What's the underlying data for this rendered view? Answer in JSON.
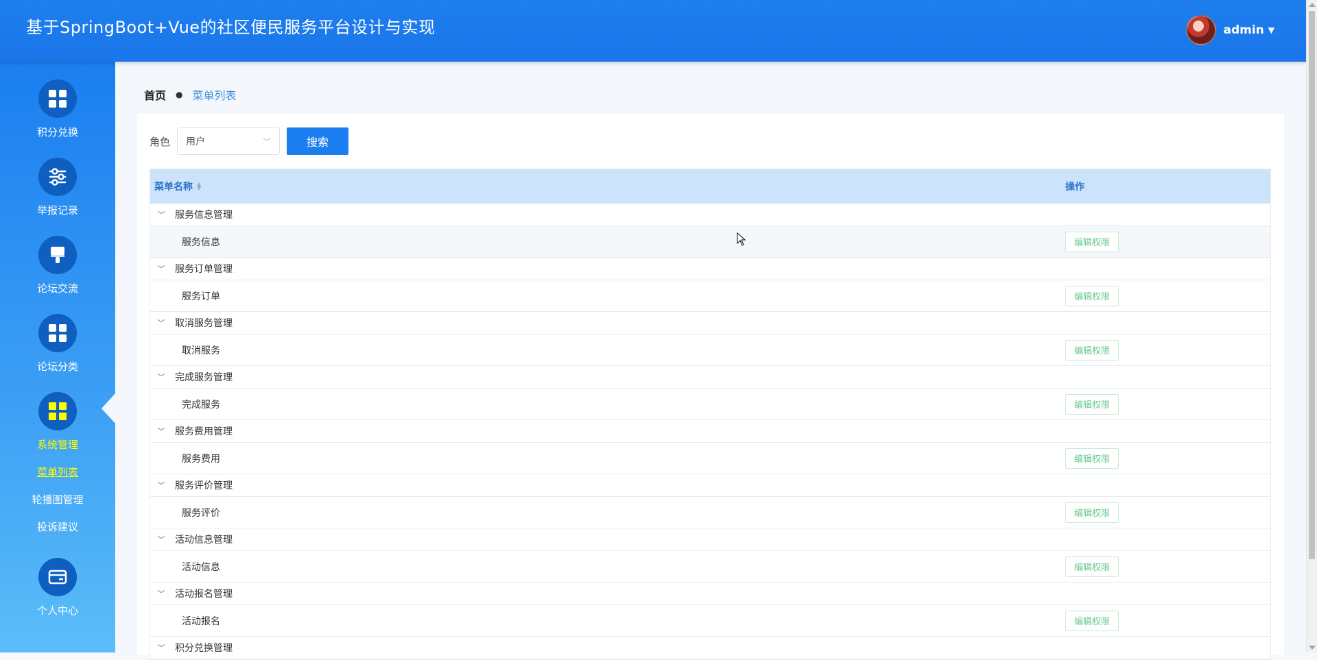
{
  "header": {
    "title": "基于SpringBoot+Vue的社区便民服务平台设计与实现",
    "username": "admin"
  },
  "sidebar": {
    "items": [
      {
        "label": "积分兑换",
        "icon": "grid-icon"
      },
      {
        "label": "举报记录",
        "icon": "sliders-icon"
      },
      {
        "label": "论坛交流",
        "icon": "brush-icon"
      },
      {
        "label": "论坛分类",
        "icon": "grid-icon"
      },
      {
        "label": "系统管理",
        "icon": "grid-icon",
        "active": true
      },
      {
        "label": "个人中心",
        "icon": "card-icon"
      }
    ],
    "subitems": [
      {
        "label": "菜单列表",
        "active": true
      },
      {
        "label": "轮播图管理"
      },
      {
        "label": "投诉建议"
      }
    ]
  },
  "breadcrumb": {
    "home": "首页",
    "current": "菜单列表"
  },
  "search": {
    "role_label": "角色",
    "role_value": "用户",
    "button": "搜索"
  },
  "table": {
    "columns": [
      "菜单名称",
      "操作"
    ],
    "edit_label": "编辑权限",
    "rows": [
      {
        "type": "group",
        "name": "服务信息管理"
      },
      {
        "type": "child",
        "name": "服务信息"
      },
      {
        "type": "group",
        "name": "服务订单管理"
      },
      {
        "type": "child",
        "name": "服务订单"
      },
      {
        "type": "group",
        "name": "取消服务管理"
      },
      {
        "type": "child",
        "name": "取消服务"
      },
      {
        "type": "group",
        "name": "完成服务管理"
      },
      {
        "type": "child",
        "name": "完成服务"
      },
      {
        "type": "group",
        "name": "服务费用管理"
      },
      {
        "type": "child",
        "name": "服务费用"
      },
      {
        "type": "group",
        "name": "服务评价管理"
      },
      {
        "type": "child",
        "name": "服务评价"
      },
      {
        "type": "group",
        "name": "活动信息管理"
      },
      {
        "type": "child",
        "name": "活动信息"
      },
      {
        "type": "group",
        "name": "活动报名管理"
      },
      {
        "type": "child",
        "name": "活动报名"
      },
      {
        "type": "group",
        "name": "积分兑换管理"
      }
    ]
  },
  "colors": {
    "primary": "#1a7ef0",
    "active_nav": "#ffff00",
    "edit_text": "#67c98c",
    "table_header": "#cce3fb"
  }
}
